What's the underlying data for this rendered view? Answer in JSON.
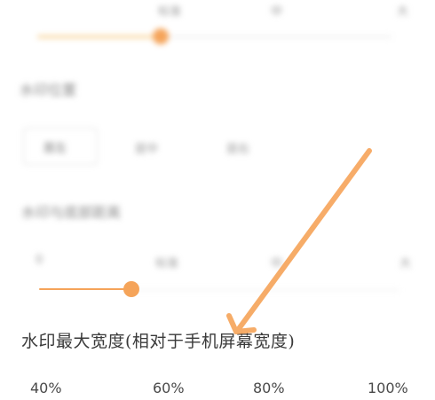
{
  "blurred_section": {
    "top_ticks": [
      "标准",
      "中",
      "大"
    ],
    "top_slider_level": 0.42,
    "position_label": "水印位置",
    "position_options": [
      "居左",
      "居中",
      "居右"
    ],
    "distance_label": "水印与底部距离",
    "mid_ticks": [
      "0",
      "标准",
      "中",
      "大"
    ],
    "mid_slider_level": 0.27
  },
  "max_width": {
    "label": "水印最大宽度(相对于手机屏幕宽度)",
    "ticks": [
      "40%",
      "60%",
      "80%",
      "100%"
    ]
  },
  "colors": {
    "accent": "#f5a45a",
    "arrow": "#f6a55c"
  }
}
